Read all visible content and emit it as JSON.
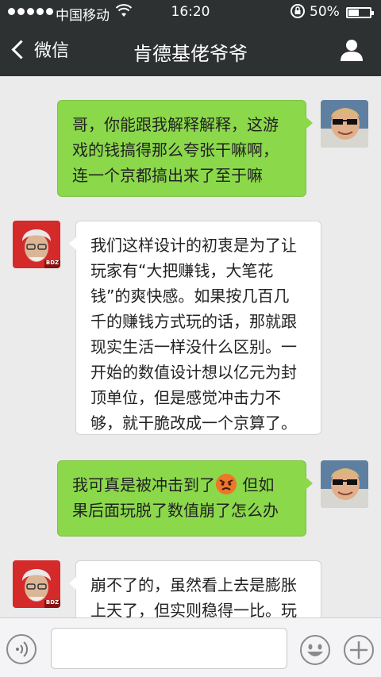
{
  "status_bar": {
    "carrier": "中国移动",
    "time": "16:20",
    "battery": "50%",
    "battery_level": 0.5
  },
  "nav": {
    "back_label": "微信",
    "title": "肯德基佬爷爷"
  },
  "messages": [
    {
      "side": "right",
      "lines": [
        "哥，你能跟我解释解释，这游",
        "戏的钱搞得那么夸张干嘛啊，",
        "连一个京都搞出来了至于嘛"
      ]
    },
    {
      "side": "left",
      "lines": [
        "我们这样设计的初衷是为了让",
        "玩家有“大把赚钱，大笔花",
        "钱”的爽快感。如果按几百几",
        "千的赚钱方式玩的话，那就跟",
        "现实生活一样没什么区别。一",
        "开始的数值设计想以亿元为封",
        "顶单位，但是感觉冲击力不",
        "够，就干脆改成一个京算了。"
      ]
    },
    {
      "side": "right",
      "lines": [
        "我可真是被冲击到了",
        " 但如",
        "果后面玩脱了数值崩了怎么办"
      ]
    },
    {
      "side": "left",
      "lines": [
        "崩不了的，虽然看上去是膨胀",
        "上天了，但实则稳得一比。玩"
      ]
    }
  ],
  "avatar_badge": "BDZ",
  "composer": {
    "placeholder": ""
  },
  "colors": {
    "bar": "#2e3132",
    "bubble_right": "#8bd84b",
    "bubble_left": "#ffffff",
    "background": "#ebebeb"
  }
}
